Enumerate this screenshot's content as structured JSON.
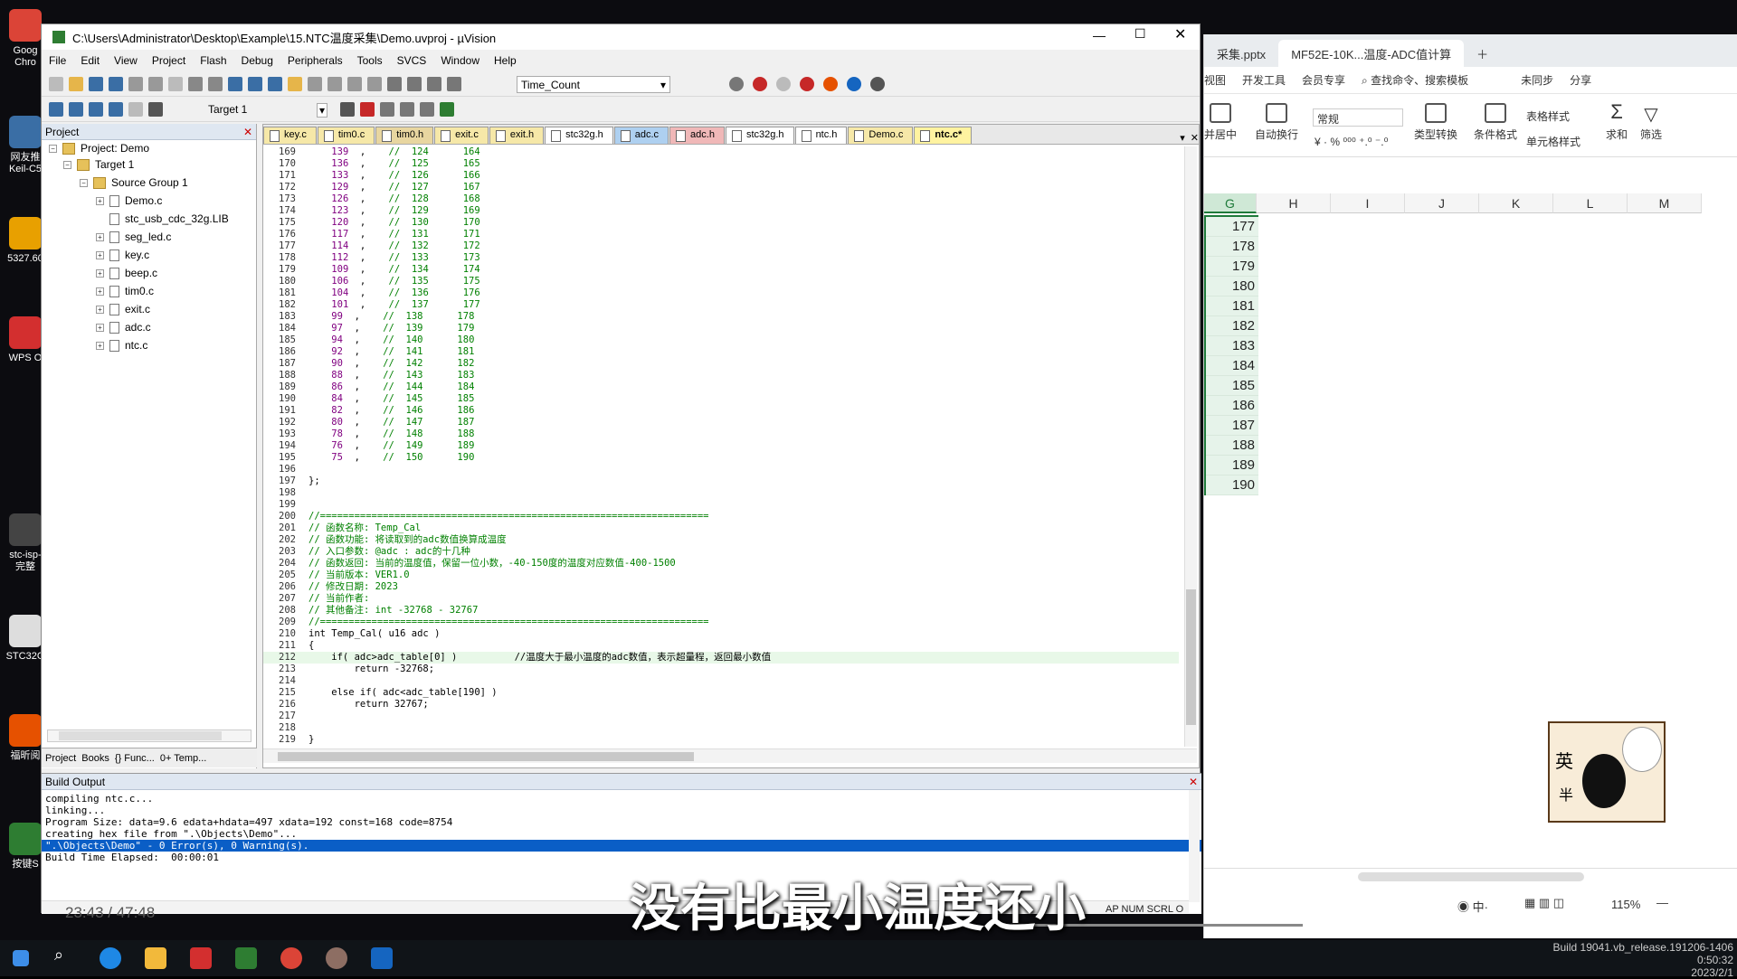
{
  "desktop": {
    "icons": [
      {
        "label": "Goog\nChro",
        "color": "#db4437"
      },
      {
        "label": "网友推\nKeil-C5",
        "color": "#3a6ea5"
      },
      {
        "label": "5327.60",
        "color": "#e8a000"
      },
      {
        "label": "WPS O",
        "color": "#d32f2f"
      },
      {
        "label": "stc-isp-\n完整",
        "color": "#444"
      },
      {
        "label": "STC32G",
        "color": "#ddd"
      },
      {
        "label": "福昕阅",
        "color": "#e65100"
      },
      {
        "label": "按键S",
        "color": "#2e7d32"
      }
    ]
  },
  "keil": {
    "title": "C:\\Users\\Administrator\\Desktop\\Example\\15.NTC温度采集\\Demo.uvproj - µVision",
    "menu": [
      "File",
      "Edit",
      "View",
      "Project",
      "Flash",
      "Debug",
      "Peripherals",
      "Tools",
      "SVCS",
      "Window",
      "Help"
    ],
    "toolbar": {
      "func_combo": "Time_Count",
      "target_combo": "Target 1"
    },
    "project_panel": {
      "header": "Project",
      "root": "Project: Demo",
      "target": "Target 1",
      "group": "Source Group 1",
      "files": [
        "Demo.c",
        "stc_usb_cdc_32g.LIB",
        "seg_led.c",
        "key.c",
        "beep.c",
        "tim0.c",
        "exit.c",
        "adc.c",
        "ntc.c"
      ],
      "bottom_tabs": [
        "Project",
        "Books",
        "{} Func...",
        "0+ Temp..."
      ]
    },
    "file_tabs": [
      "key.c",
      "tim0.c",
      "tim0.h",
      "exit.c",
      "exit.h",
      "stc32g.h",
      "adc.c",
      "adc.h",
      "stc32g.h",
      "ntc.h",
      "Demo.c",
      "ntc.c*"
    ],
    "table_rows": [
      {
        "ln": "169",
        "v": "139",
        "a": "124",
        "b": "164"
      },
      {
        "ln": "170",
        "v": "136",
        "a": "125",
        "b": "165"
      },
      {
        "ln": "171",
        "v": "133",
        "a": "126",
        "b": "166"
      },
      {
        "ln": "172",
        "v": "129",
        "a": "127",
        "b": "167"
      },
      {
        "ln": "173",
        "v": "126",
        "a": "128",
        "b": "168"
      },
      {
        "ln": "174",
        "v": "123",
        "a": "129",
        "b": "169"
      },
      {
        "ln": "175",
        "v": "120",
        "a": "130",
        "b": "170"
      },
      {
        "ln": "176",
        "v": "117",
        "a": "131",
        "b": "171"
      },
      {
        "ln": "177",
        "v": "114",
        "a": "132",
        "b": "172"
      },
      {
        "ln": "178",
        "v": "112",
        "a": "133",
        "b": "173"
      },
      {
        "ln": "179",
        "v": "109",
        "a": "134",
        "b": "174"
      },
      {
        "ln": "180",
        "v": "106",
        "a": "135",
        "b": "175"
      },
      {
        "ln": "181",
        "v": "104",
        "a": "136",
        "b": "176"
      },
      {
        "ln": "182",
        "v": "101",
        "a": "137",
        "b": "177"
      },
      {
        "ln": "183",
        "v": "99",
        "a": "138",
        "b": "178"
      },
      {
        "ln": "184",
        "v": "97",
        "a": "139",
        "b": "179"
      },
      {
        "ln": "185",
        "v": "94",
        "a": "140",
        "b": "180"
      },
      {
        "ln": "186",
        "v": "92",
        "a": "141",
        "b": "181"
      },
      {
        "ln": "187",
        "v": "90",
        "a": "142",
        "b": "182"
      },
      {
        "ln": "188",
        "v": "88",
        "a": "143",
        "b": "183"
      },
      {
        "ln": "189",
        "v": "86",
        "a": "144",
        "b": "184"
      },
      {
        "ln": "190",
        "v": "84",
        "a": "145",
        "b": "185"
      },
      {
        "ln": "191",
        "v": "82",
        "a": "146",
        "b": "186"
      },
      {
        "ln": "192",
        "v": "80",
        "a": "147",
        "b": "187"
      },
      {
        "ln": "193",
        "v": "78",
        "a": "148",
        "b": "188"
      },
      {
        "ln": "194",
        "v": "76",
        "a": "149",
        "b": "189"
      },
      {
        "ln": "195",
        "v": "75",
        "a": "150",
        "b": "190"
      }
    ],
    "code_lines": [
      {
        "ln": "196",
        "t": "",
        "c": ""
      },
      {
        "ln": "197",
        "t": "};",
        "c": ""
      },
      {
        "ln": "198",
        "t": "",
        "c": ""
      },
      {
        "ln": "199",
        "t": "",
        "c": ""
      },
      {
        "ln": "200",
        "t": "//====================================================================",
        "c": "cm"
      },
      {
        "ln": "201",
        "t": "// 函数名称: Temp_Cal",
        "c": "cm"
      },
      {
        "ln": "202",
        "t": "// 函数功能: 将读取到的adc数值换算成温度",
        "c": "cm"
      },
      {
        "ln": "203",
        "t": "// 入口参数: @adc : adc的十几种",
        "c": "cm"
      },
      {
        "ln": "204",
        "t": "// 函数返回: 当前的温度值，保留一位小数，-40-150度的温度对应数值-400-1500",
        "c": "cm"
      },
      {
        "ln": "205",
        "t": "// 当前版本: VER1.0",
        "c": "cm"
      },
      {
        "ln": "206",
        "t": "// 修改日期: 2023",
        "c": "cm"
      },
      {
        "ln": "207",
        "t": "// 当前作者:",
        "c": "cm"
      },
      {
        "ln": "208",
        "t": "// 其他备注: int -32768 - 32767",
        "c": "cm"
      },
      {
        "ln": "209",
        "t": "//====================================================================",
        "c": "cm"
      },
      {
        "ln": "210",
        "t": "int Temp_Cal( u16 adc )",
        "c": ""
      },
      {
        "ln": "211",
        "t": "{",
        "c": ""
      },
      {
        "ln": "212",
        "t": "    if( adc>adc_table[0] )          //温度大于最小温度的adc数值，表示超量程，返回最小数值",
        "c": "hl"
      },
      {
        "ln": "213",
        "t": "        return -32768;",
        "c": ""
      },
      {
        "ln": "214",
        "t": "",
        "c": ""
      },
      {
        "ln": "215",
        "t": "    else if( adc<adc_table[190] )",
        "c": ""
      },
      {
        "ln": "216",
        "t": "        return 32767;",
        "c": ""
      },
      {
        "ln": "217",
        "t": "",
        "c": ""
      },
      {
        "ln": "218",
        "t": "",
        "c": ""
      },
      {
        "ln": "219",
        "t": "}",
        "c": ""
      }
    ],
    "build_output": {
      "header": "Build Output",
      "lines": [
        "compiling ntc.c...",
        "linking...",
        "Program Size: data=9.6 edata+hdata=497 xdata=192 const=168 code=8754",
        "creating hex file from \".\\Objects\\Demo\"...",
        "\".\\Objects\\Demo\" - 0 Error(s), 0 Warning(s).",
        "Build Time Elapsed:  00:00:01"
      ]
    }
  },
  "wps": {
    "tabs": [
      "采集.pptx",
      "MF52E-10K...温度-ADC值计算"
    ],
    "menu": [
      "视图",
      "开发工具",
      "会员专享",
      "查找命令、搜索模板",
      "未同步",
      "分享"
    ],
    "ribbon": [
      "并居中",
      "自动换行",
      "常规",
      "类型转换",
      "条件格式",
      "表格样式",
      "单元格样式",
      "求和",
      "筛选"
    ],
    "columns": [
      "G",
      "H",
      "I",
      "J",
      "K",
      "L",
      "M"
    ],
    "g_values": [
      "177",
      "178",
      "179",
      "180",
      "181",
      "182",
      "183",
      "184",
      "185",
      "186",
      "187",
      "188",
      "189",
      "190"
    ],
    "zoom": "115%",
    "status_left": "AP NUM SCRL O"
  },
  "taskbar": {
    "build": "Build 19041.vb_release.191206-1406",
    "time": "0:50:32",
    "date": "2023/2/1"
  },
  "video": {
    "subtitle": "没有比最小温度还小",
    "timecode": "23:43 / 47:48"
  }
}
